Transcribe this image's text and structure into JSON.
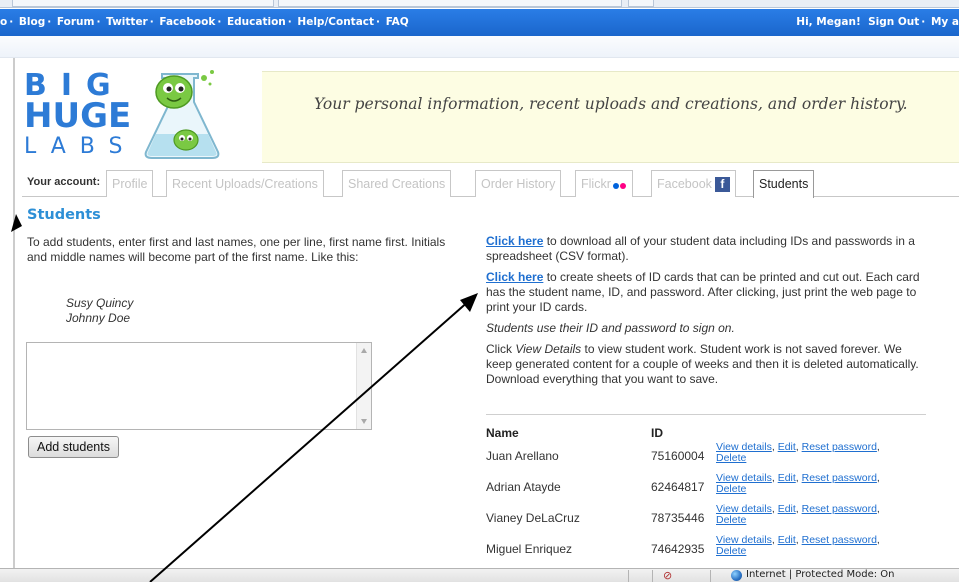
{
  "browser": {
    "status_zone": "Internet | Protected Mode: On"
  },
  "topnav": {
    "left_items": [
      "o",
      "Blog",
      "Forum",
      "Twitter",
      "Facebook",
      "Education",
      "Help/Contact",
      "FAQ"
    ],
    "separator": "·",
    "greeting": "Hi, Megan!",
    "sign_out": "Sign Out",
    "my_account": "My a"
  },
  "logo": {
    "line1": "BIG",
    "line2": "HUGE",
    "line3": "LABS"
  },
  "banner": {
    "message": "Your personal information, recent uploads and creations, and order history."
  },
  "account_tabs": {
    "label": "Your account:",
    "tabs": [
      {
        "label": "Profile",
        "active": false
      },
      {
        "label": "Recent Uploads/Creations",
        "active": false
      },
      {
        "label": "Shared Creations",
        "active": false
      },
      {
        "label": "Order History",
        "active": false
      },
      {
        "label": "Flickr",
        "active": false
      },
      {
        "label": "Facebook",
        "active": false
      },
      {
        "label": "Students",
        "active": true
      }
    ],
    "facebook_glyph": "f"
  },
  "students": {
    "title": "Students",
    "instructions": "To add students, enter first and last names, one per line, first name first. Initials and middle names will become part of the first name. Like this:",
    "example_1": "Susy Quincy",
    "example_2": "Johnny Doe",
    "textarea_value": "",
    "add_button": "Add students",
    "download_link": "Click here",
    "download_text": " to download all of your student data including IDs and passwords in a spreadsheet (CSV format).",
    "idcards_link": "Click here",
    "idcards_text": " to create sheets of ID cards that can be printed and cut out. Each card has the student name, ID, and password. After clicking, just print the web page to print your ID cards.",
    "signon_note": "Students use their ID and password to sign on.",
    "details_prefix": "Click ",
    "details_em": "View Details",
    "details_suffix": " to view student work. Student work is not saved forever. We keep generated content for a couple of weeks and then it is deleted automatically. Download everything that you want to save.",
    "col_name": "Name",
    "col_id": "ID",
    "actions": {
      "view": "View details",
      "edit": "Edit",
      "reset": "Reset password",
      "delete": "Delete",
      "comma": ", "
    },
    "rows": [
      {
        "name": "Juan Arellano",
        "id": "75160004"
      },
      {
        "name": "Adrian Atayde",
        "id": "62464817"
      },
      {
        "name": "Vianey DeLaCruz",
        "id": "78735446"
      },
      {
        "name": "Miguel Enriquez",
        "id": "74642935"
      }
    ]
  },
  "colors": {
    "topbar": "#1a66cc",
    "link": "#1f6fd0",
    "title": "#2d8fd6",
    "banner": "#fdfde3"
  }
}
